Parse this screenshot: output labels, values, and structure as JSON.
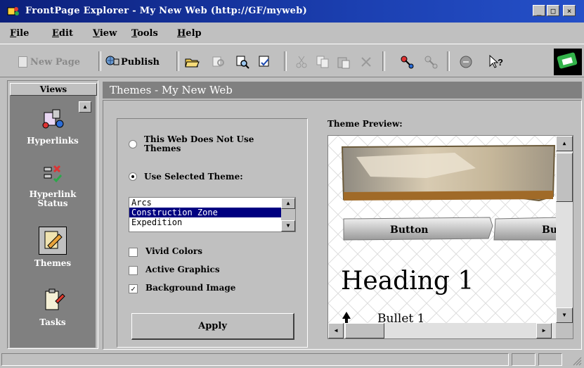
{
  "window": {
    "title": "FrontPage Explorer - My New Web (http://GF/myweb)",
    "controls": [
      "_",
      "□",
      "×"
    ]
  },
  "menu": {
    "items": [
      {
        "key": "F",
        "rest": "ile"
      },
      {
        "key": "E",
        "rest": "dit"
      },
      {
        "key": "V",
        "rest": "iew"
      },
      {
        "key": "T",
        "rest": "ools"
      },
      {
        "key": "H",
        "rest": "elp"
      }
    ]
  },
  "toolbar": {
    "new_page": "New Page",
    "publish": "Publish"
  },
  "views": {
    "header": "Views",
    "items": [
      {
        "label": "Hyperlinks",
        "icon": "hyperlinks-icon"
      },
      {
        "label": "Hyperlink Status",
        "icon": "hyperlink-status-icon"
      },
      {
        "label": "Themes",
        "icon": "themes-icon"
      },
      {
        "label": "Tasks",
        "icon": "tasks-icon"
      }
    ]
  },
  "content": {
    "title": "Themes - My New Web",
    "options": {
      "no_theme": "This Web Does Not Use Themes",
      "use_selected": "Use Selected Theme:",
      "theme_list": [
        "Arcs",
        "Construction Zone",
        "Expedition"
      ],
      "selected_theme": "Construction Zone",
      "vivid_colors": "Vivid Colors",
      "active_graphics": "Active Graphics",
      "background_image": "Background Image",
      "vivid_colors_checked": false,
      "active_graphics_checked": false,
      "background_image_checked": true,
      "apply": "Apply"
    },
    "preview": {
      "label": "Theme Preview:",
      "button_text": "Button",
      "button_text_2": "Bu",
      "heading": "Heading 1",
      "bullet": "Bullet 1"
    }
  }
}
